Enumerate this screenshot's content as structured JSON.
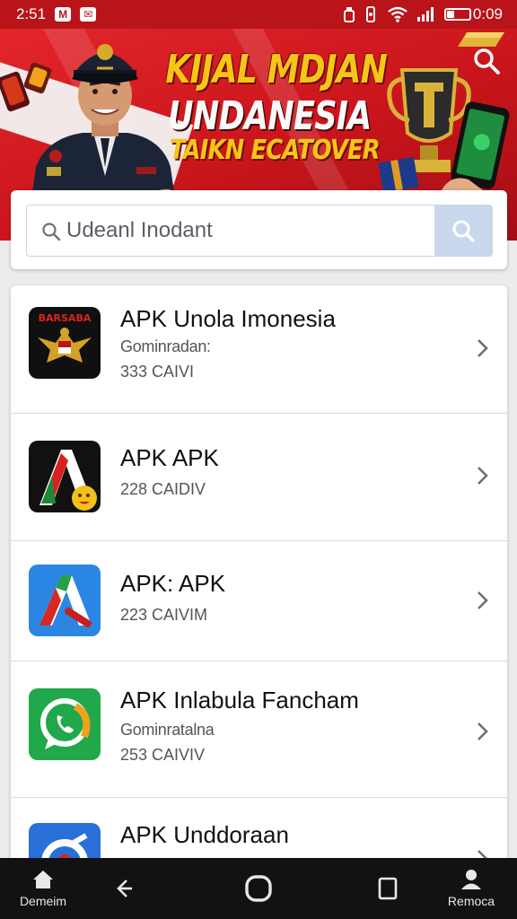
{
  "status_bar": {
    "time": "2:51",
    "notif_badge_1": "M",
    "notif_badge_2": "✉",
    "battery_text": "0:09",
    "battery_level": 0.35
  },
  "banner": {
    "line1": "KIJAL MDJAN",
    "line2": "UNDANESIA",
    "line3": "TAIKN ECATOVER"
  },
  "search": {
    "value": "Udeanl Inodant"
  },
  "apps": [
    {
      "title": "APK Unola Imonesia",
      "subtitle": "Gominradan:",
      "size": "333 CAIVI",
      "icon": "garuda-icon",
      "icon_text": "BARSABA"
    },
    {
      "title": "APK  APK",
      "subtitle": "",
      "size": "228 CAIDIV",
      "icon": "red-a-icon",
      "icon_text": ""
    },
    {
      "title": "APK: APK",
      "subtitle": "",
      "size": "223 CAIVIM",
      "icon": "blue-a-icon",
      "icon_text": ""
    },
    {
      "title": "APK  Inlabula Fancham",
      "subtitle": "Gominratalna",
      "size": "253 CAIVIV",
      "icon": "whatsapp-icon",
      "icon_text": ""
    },
    {
      "title": "APK  Unddoraan",
      "subtitle": "",
      "size": "",
      "icon": "blue-g-icon",
      "icon_text": ""
    }
  ],
  "nav": {
    "home_label": "Demeim",
    "profile_label": "Remoca"
  },
  "colors": {
    "banner_red": "#c8151b",
    "banner_gold": "#f5c518",
    "search_button": "#c9d8ec",
    "nav_bg": "#121212"
  }
}
